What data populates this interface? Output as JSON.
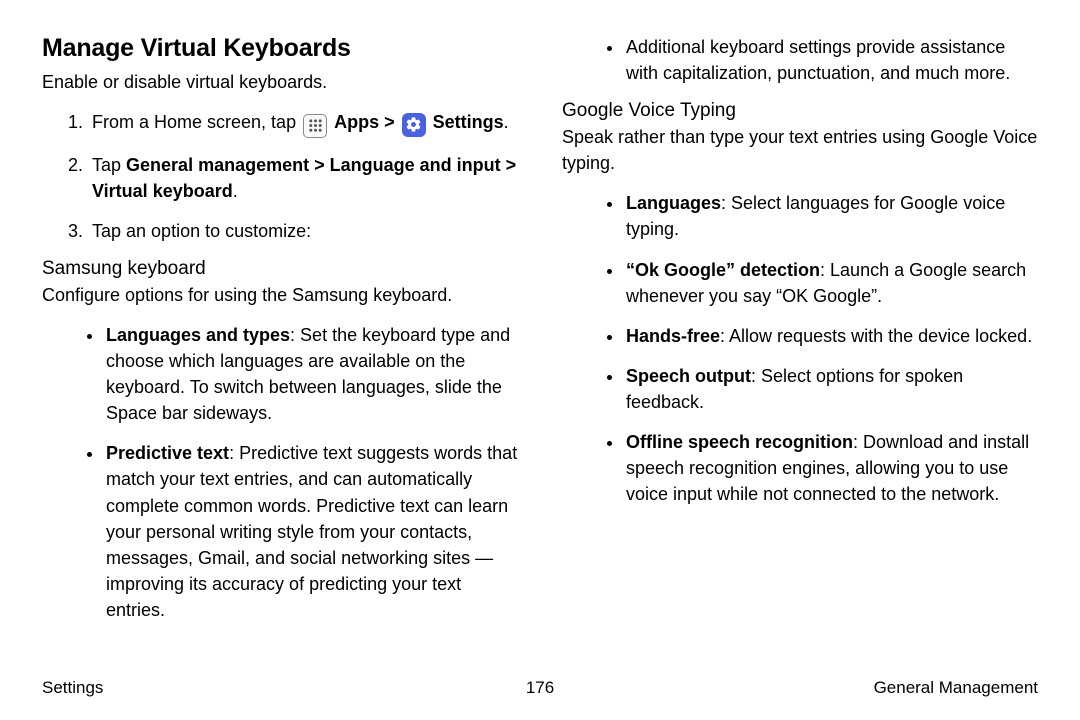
{
  "page": {
    "title": "Manage Virtual Keyboards",
    "intro": "Enable or disable virtual keyboards."
  },
  "steps": {
    "s1_a": "From a Home screen, tap ",
    "s1_apps": "Apps",
    "s1_sep": " > ",
    "s1_settings": "Settings",
    "s1_end": ".",
    "s2_a": "Tap ",
    "s2_b": "General management > Language and input > Virtual keyboard",
    "s2_c": ".",
    "s3": "Tap an option to customize:"
  },
  "samsung": {
    "heading": "Samsung keyboard",
    "desc": "Configure options for using the Samsung keyboard.",
    "b1_label": "Languages and types",
    "b1_text": ": Set the keyboard type and choose which languages are available on the keyboard. To switch between languages, slide the Space bar sideways.",
    "b2_label": "Predictive text",
    "b2_text": ": Predictive text suggests words that match your text entries, and can automatically complete common words. Predictive text can learn your personal writing style from your contacts, messages, Gmail, and social networking sites — improving its accuracy of predicting your text entries.",
    "b3_text": "Additional keyboard settings provide assistance with capitalization, punctuation, and much more."
  },
  "gvt": {
    "heading": "Google Voice Typing",
    "desc": "Speak rather than type your text entries using Google Voice typing.",
    "b1_label": "Languages",
    "b1_text": ": Select languages for Google voice typing.",
    "b2_label": "“Ok Google” detection",
    "b2_text": ": Launch a Google search whenever you say “OK Google”.",
    "b3_label": "Hands-free",
    "b3_text": ": Allow requests with the device locked.",
    "b4_label": "Speech output",
    "b4_text": ": Select options for spoken feedback.",
    "b5_label": "Offline speech recognition",
    "b5_text": ": Download and install speech recognition engines, allowing you to use voice input while not connected to the network."
  },
  "footer": {
    "left": "Settings",
    "page_num": "176",
    "right": "General Management"
  }
}
